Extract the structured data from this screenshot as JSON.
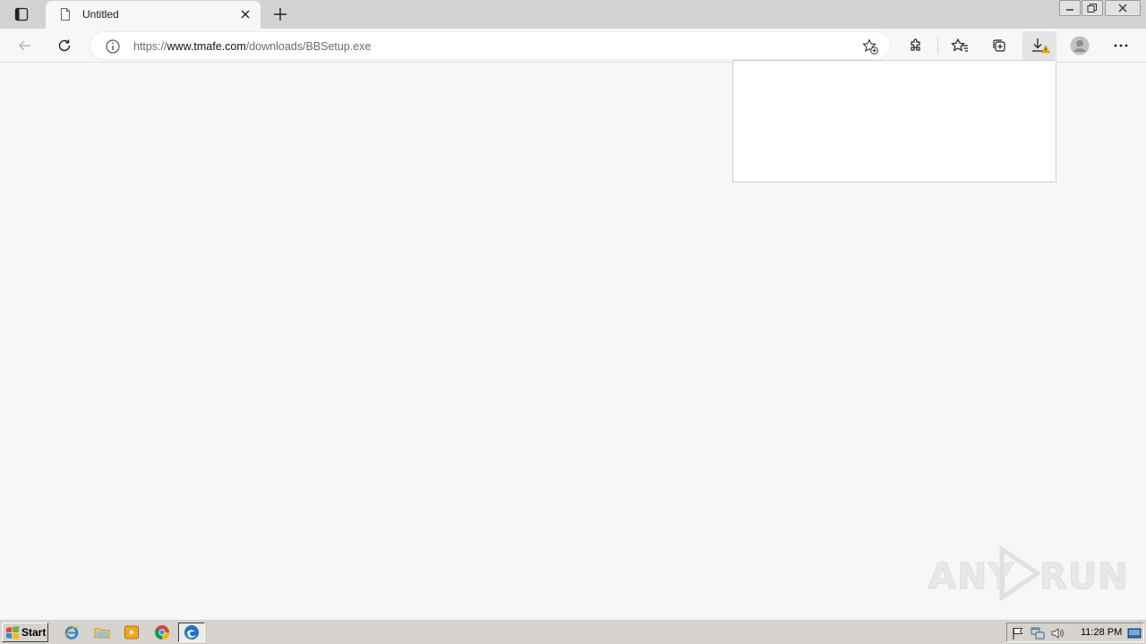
{
  "browser": {
    "tab": {
      "title": "Untitled"
    },
    "address_bar": {
      "url_prefix": "https://",
      "url_host": "www.tmafe.com",
      "url_path": "/downloads/BBSetup.exe"
    },
    "window_controls": [
      "minimize",
      "restore",
      "close"
    ],
    "toolbar_icons": [
      "back-icon",
      "refresh-icon",
      "site-info-icon",
      "add-favorite-icon",
      "extensions-icon",
      "favorites-icon",
      "collections-icon",
      "downloads-warning-icon",
      "profile-icon",
      "more-icon"
    ]
  },
  "watermark": {
    "left": "ANY",
    "right": "RUN"
  },
  "taskbar": {
    "start_label": "Start",
    "apps": [
      "internet-explorer-icon",
      "file-explorer-icon",
      "media-player-icon",
      "chrome-icon",
      "edge-icon"
    ],
    "clock": "11:28 PM"
  },
  "colors": {
    "chrome_bg": "#d3d3d3",
    "page_bg": "#f7f7f7",
    "taskbar_bg": "#d6d3ce",
    "warning": "#f2b90f"
  }
}
